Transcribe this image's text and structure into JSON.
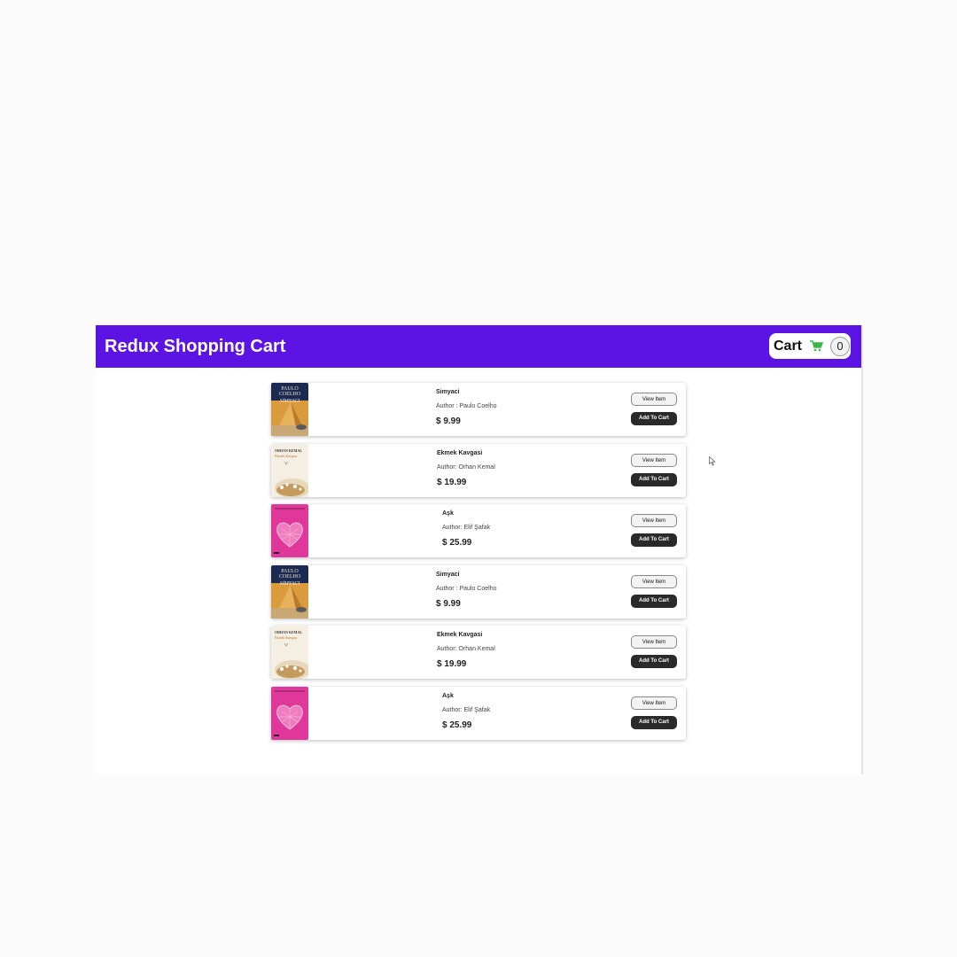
{
  "header": {
    "title": "Redux Shopping Cart",
    "cart_label": "Cart",
    "cart_count": "0",
    "cart_icon": "shopping-cart-icon",
    "brand_color": "#5b14e4",
    "cart_icon_color": "#3cb54a"
  },
  "buttons": {
    "view": "View Item",
    "add": "Add To Cart"
  },
  "products": [
    {
      "title": "Simyaci",
      "author": "Author : Paulo Coelho",
      "price": "$ 9.99",
      "cover": "simyaci-cover"
    },
    {
      "title": "Ekmek Kavgasi",
      "author": "Author: Orhan Kemal",
      "price": "$ 19.99",
      "cover": "ekmek-kavgasi-cover"
    },
    {
      "title": "Aşk",
      "author": "Author: Elif Şafak",
      "price": "$ 25.99",
      "cover": "ask-cover"
    },
    {
      "title": "Simyaci",
      "author": "Author : Paulo Coelho",
      "price": "$ 9.99",
      "cover": "simyaci-cover"
    },
    {
      "title": "Ekmek Kavgasi",
      "author": "Author: Orhan Kemal",
      "price": "$ 19.99",
      "cover": "ekmek-kavgasi-cover"
    },
    {
      "title": "Aşk",
      "author": "Author: Elif Şafak",
      "price": "$ 25.99",
      "cover": "ask-cover"
    }
  ],
  "cover_text": {
    "simyaci": {
      "author_top": "PAULO",
      "author_bottom": "COELHO",
      "title": "SİMYACI"
    },
    "ekmek": {
      "author": "ORHAN KEMAL",
      "title": "Ekmek Kavgası"
    }
  }
}
